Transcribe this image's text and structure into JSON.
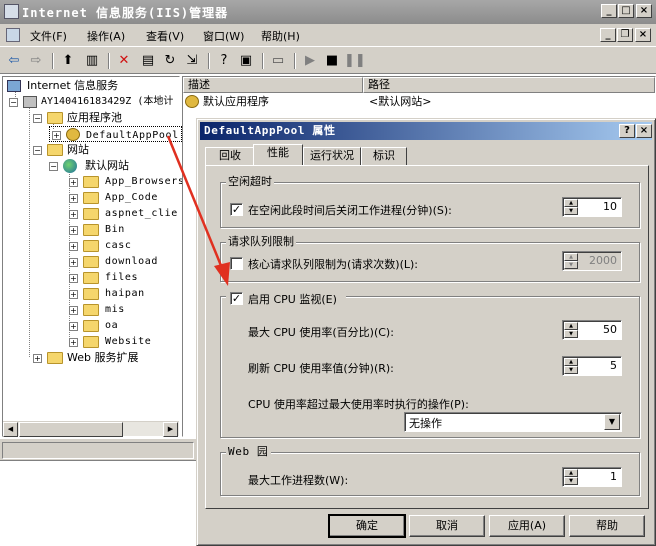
{
  "window": {
    "title": "Internet 信息服务(IIS)管理器"
  },
  "menu": [
    "文件(F)",
    "操作(A)",
    "查看(V)",
    "窗口(W)",
    "帮助(H)"
  ],
  "tree": {
    "root": "Internet 信息服务",
    "server": "AY140416183429Z (本地计",
    "app_pools": "应用程序池",
    "default_pool": "DefaultAppPool",
    "websites": "网站",
    "default_site": "默认网站",
    "folders": [
      "App_Browsers",
      "App_Code",
      "aspnet_clier",
      "Bin",
      "casc",
      "download",
      "files",
      "haipan",
      "mis",
      "oa",
      "Website"
    ],
    "web_ext": "Web 服务扩展"
  },
  "list": {
    "col_desc": "描述",
    "col_path": "路径",
    "row_desc": "默认应用程序",
    "row_path": "<默认网站>"
  },
  "dialog": {
    "title": "DefaultAppPool 属性",
    "tabs": [
      "回收",
      "性能",
      "运行状况",
      "标识"
    ],
    "idle_group": "空闲超时",
    "idle_check": "在空闲此段时间后关闭工作进程(分钟)(S):",
    "idle_value": "10",
    "queue_group": "请求队列限制",
    "queue_check": "核心请求队列限制为(请求次数)(L):",
    "queue_value": "2000",
    "cpu_check": "启用 CPU 监视(E)",
    "cpu_max_label": "最大 CPU 使用率(百分比)(C):",
    "cpu_max_value": "50",
    "cpu_refresh_label": "刷新 CPU 使用率值(分钟)(R):",
    "cpu_refresh_value": "5",
    "cpu_action_label": "CPU 使用率超过最大使用率时执行的操作(P):",
    "cpu_action_value": "无操作",
    "garden_group": "Web 园",
    "garden_label": "最大工作进程数(W):",
    "garden_value": "1",
    "ok": "确定",
    "cancel": "取消",
    "apply": "应用(A)",
    "help": "帮助"
  },
  "colors": {
    "arrow": "#e03020",
    "title_active": "#0a246a"
  }
}
